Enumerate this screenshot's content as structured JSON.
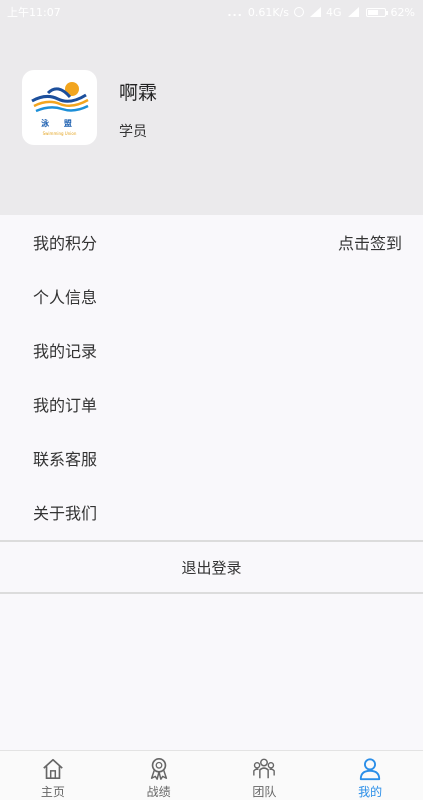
{
  "status_bar": {
    "time": "上午11:07",
    "dots": "...",
    "speed": "0.61K/s",
    "network": "4G",
    "battery_text": "62%",
    "battery_level": 0.62
  },
  "profile": {
    "name": "啊霖",
    "role": "学员",
    "logo_text": "泳 盟",
    "logo_sub": "Swimming Union"
  },
  "menu": {
    "items": [
      {
        "label": "我的积分",
        "right": "点击签到"
      },
      {
        "label": "个人信息",
        "right": ""
      },
      {
        "label": "我的记录",
        "right": ""
      },
      {
        "label": "我的订单",
        "right": ""
      },
      {
        "label": "联系客服",
        "right": ""
      },
      {
        "label": "关于我们",
        "right": ""
      }
    ],
    "logout": "退出登录"
  },
  "tabbar": {
    "tabs": [
      {
        "label": "主页",
        "icon": "home-icon",
        "active": false
      },
      {
        "label": "战绩",
        "icon": "medal-icon",
        "active": false
      },
      {
        "label": "团队",
        "icon": "team-icon",
        "active": false
      },
      {
        "label": "我的",
        "icon": "user-icon",
        "active": true
      }
    ]
  },
  "colors": {
    "header_bg": "#ebeaec",
    "page_bg": "#f9f8fb",
    "accent": "#2a8ee8",
    "inactive": "#666666"
  }
}
